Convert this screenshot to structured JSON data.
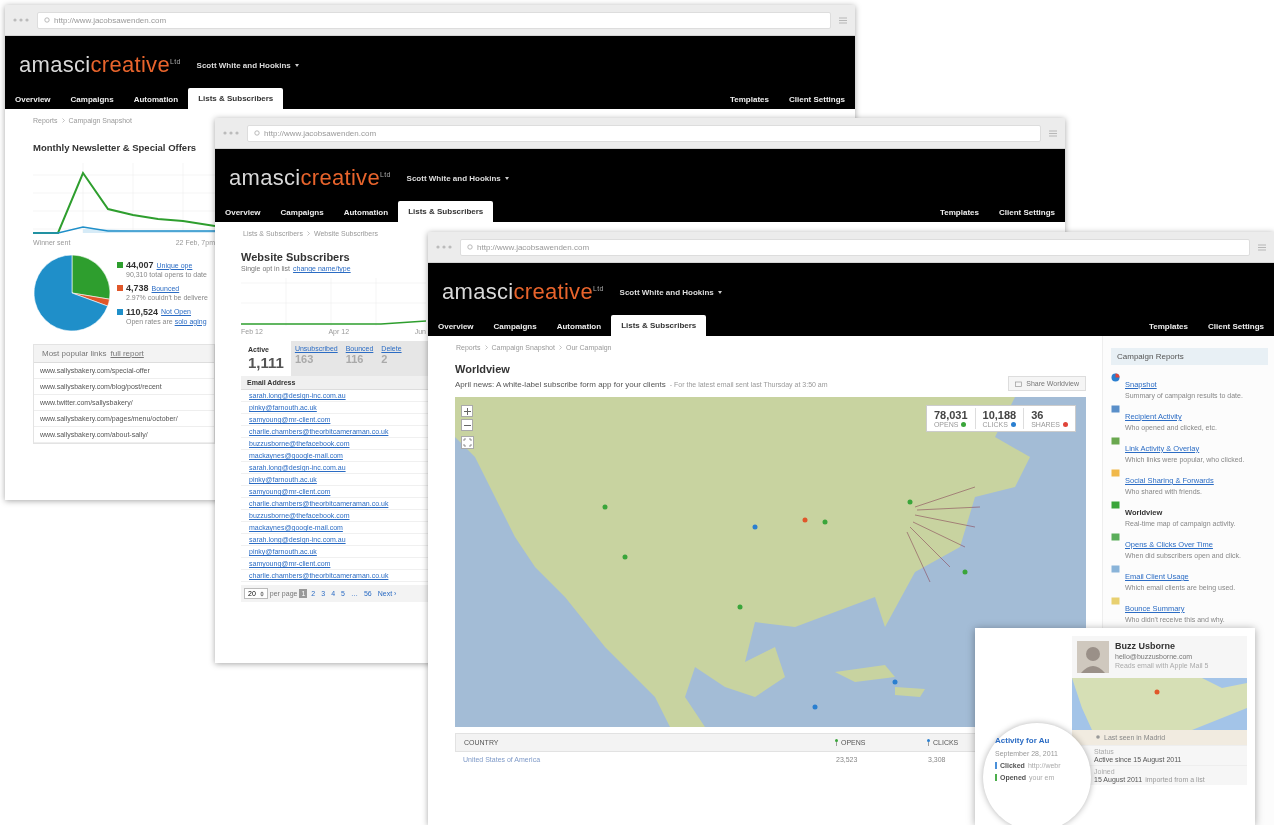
{
  "back_window": {
    "browser": {
      "url": "http://www.jacobsawenden.com"
    },
    "header": {
      "brand_a": "amasci",
      "brand_b": "creative",
      "brand_sup": "Ltd",
      "account": "Scott White and Hookins",
      "tabs": [
        {
          "label": "Overview",
          "selected": false
        },
        {
          "label": "Campaigns",
          "selected": false
        },
        {
          "label": "Automation",
          "selected": false
        },
        {
          "label": "Lists & Subscribers",
          "selected": true
        }
      ],
      "right_tabs": [
        "Templates",
        "Client Settings"
      ]
    },
    "breadcrumb": [
      "Reports",
      "Campaign Snapshot"
    ],
    "title": "Monthly Newsletter & Special Offers",
    "line_chart": {
      "x_labels": [
        "Winner sent",
        "22 Feb, 7pm"
      ]
    },
    "pie": {
      "chart_data": {
        "type": "pie",
        "values": [
          27.6,
          3.0,
          69.4
        ]
      }
    },
    "legend": [
      {
        "value": "44,007",
        "link": "Unique ope",
        "note": "90,310 total opens to date",
        "color": "#2e9e2e"
      },
      {
        "value": "4,738",
        "link": "Bounced",
        "note": "2.97% couldn't be delivere",
        "color": "#e0572a"
      },
      {
        "value": "110,524",
        "link": "Not Open",
        "note": "Open rates are",
        "note_link": "solo aging",
        "color": "#1f8fc9"
      }
    ],
    "links_panel": {
      "title": "Most popular links",
      "link": "full report",
      "items": [
        "www.sallysbakery.com/special-offer",
        "www.sallysbakery.com/blog/post/recent",
        "www.twitter.com/sallysbakery/",
        "www.sallysbakery.com/pages/menu/october/",
        "www.sallysbakery.com/about-sally/"
      ]
    }
  },
  "middle_window": {
    "browser": {
      "url": "http://www.jacobsawenden.com"
    },
    "header": {
      "brand_a": "amasci",
      "brand_b": "creative",
      "brand_sup": "Ltd",
      "account": "Scott White and Hookins",
      "tabs": [
        {
          "label": "Overview",
          "selected": false
        },
        {
          "label": "Campaigns",
          "selected": false
        },
        {
          "label": "Automation",
          "selected": false
        },
        {
          "label": "Lists & Subscribers",
          "selected": true
        }
      ],
      "right_tabs": [
        "Templates",
        "Client Settings"
      ]
    },
    "breadcrumb": [
      "Lists & Subscribers",
      "Website Subscribers"
    ],
    "title": "Website Subscribers",
    "subtitle": "Single opt in list",
    "subtitle_link": "change name/type",
    "line_chart": {
      "x_labels": [
        "Feb 12",
        "Apr 12",
        "Jun"
      ]
    },
    "tabs": [
      {
        "label": "Active",
        "count": "1,111",
        "selected": true
      },
      {
        "label": "Unsubscribed",
        "count": "163",
        "selected": false
      },
      {
        "label": "Bounced",
        "count": "116",
        "selected": false
      },
      {
        "label": "Delete",
        "count": "2",
        "selected": false
      }
    ],
    "column": "Email Address",
    "emails": [
      "sarah.long@design-inc.com.au",
      "pinky@farnouth.ac.uk",
      "samyoung@mr-client.com",
      "charlie.chambers@theorbitcameraman.co.uk",
      "buzzusborne@thefacebook.com",
      "mackaynes@google-mail.com",
      "sarah.long@design-inc.com.au",
      "pinky@farnouth.ac.uk",
      "samyoung@mr-client.com",
      "charlie.chambers@theorbitcameraman.co.uk",
      "buzzusborne@thefacebook.com",
      "mackaynes@google-mail.com",
      "sarah.long@design-inc.com.au",
      "pinky@farnouth.ac.uk",
      "samyoung@mr-client.com",
      "charlie.chambers@theorbitcameraman.co.uk"
    ],
    "pagination": {
      "per_page": "20",
      "per_page_label": "per page",
      "pages": [
        {
          "label": "1",
          "selected": true
        },
        {
          "label": "2",
          "selected": false
        },
        {
          "label": "3",
          "selected": false
        },
        {
          "label": "4",
          "selected": false
        },
        {
          "label": "5",
          "selected": false
        },
        {
          "label": "…",
          "selected": false
        },
        {
          "label": "56",
          "selected": false
        }
      ],
      "next": "Next ›"
    }
  },
  "front_window": {
    "browser": {
      "url": "http://www.jacobsawenden.com"
    },
    "header": {
      "brand_a": "amasci",
      "brand_b": "creative",
      "brand_sup": "Ltd",
      "account": "Scott White and Hookins",
      "tabs": [
        {
          "label": "Overview",
          "selected": false
        },
        {
          "label": "Campaigns",
          "selected": false
        },
        {
          "label": "Automation",
          "selected": false
        },
        {
          "label": "Lists & Subscribers",
          "selected": true
        }
      ],
      "right_tabs": [
        "Templates",
        "Client Settings"
      ]
    },
    "breadcrumb": [
      "Reports",
      "Campaign Snapshot",
      "Our Campaign"
    ],
    "title": "Worldview",
    "subtitle": "April news: A white-label subscribe form app for your clients",
    "subtitle_note": "- For the latest email sent last Thursday at 3:50 am",
    "share_button": "Share Worldview",
    "stats": [
      {
        "value": "78,031",
        "label": "OPENS",
        "color": "#3aa53a"
      },
      {
        "value": "10,188",
        "label": "CLICKS",
        "color": "#2a7fd0"
      },
      {
        "value": "36",
        "label": "SHARES",
        "color": "#e0443a"
      }
    ],
    "table": {
      "columns": [
        "COUNTRY",
        "OPENS",
        "CLICKS"
      ],
      "rows": [
        [
          "United States of America",
          "23,523",
          "3,308"
        ]
      ]
    },
    "sidebar": {
      "title": "Campaign Reports",
      "items": [
        {
          "label": "Snapshot",
          "desc": "Summary of campaign results to date.",
          "link": true
        },
        {
          "label": "Recipient Activity",
          "desc": "Who opened and clicked, etc.",
          "link": true
        },
        {
          "label": "Link Activity & Overlay",
          "desc": "Which links were popular, who clicked.",
          "link": true
        },
        {
          "label": "Social Sharing & Forwards",
          "desc": "Who shared with friends.",
          "link": true
        },
        {
          "label": "Worldview",
          "desc": "Real-time map of campaign activity.",
          "link": false
        },
        {
          "label": "Opens & Clicks Over Time",
          "desc": "When did subscribers open and click.",
          "link": true
        },
        {
          "label": "Email Client Usage",
          "desc": "Which email clients are being used.",
          "link": true
        },
        {
          "label": "Bounce Summary",
          "desc": "Who didn't receive this and why.",
          "link": true
        }
      ]
    }
  },
  "profile_card": {
    "name": "Buzz Usborne",
    "email": "hello@buzzusborne.com",
    "client": "Reads email with Apple Mail 5",
    "last_seen": "Last seen in Madrid",
    "status_label": "Status",
    "status": "Active since 15 August 2011",
    "joined_label": "Joined",
    "joined": "15 August 2011",
    "joined_note": "imported from a list"
  },
  "magnifier": {
    "title": "Activity for Au",
    "date": "September 28, 2011",
    "events": [
      {
        "action": "Clicked",
        "detail": "http://webr",
        "color": "#4a90d9"
      },
      {
        "action": "Opened",
        "detail": "your em",
        "color": "#4cae4c"
      }
    ]
  }
}
